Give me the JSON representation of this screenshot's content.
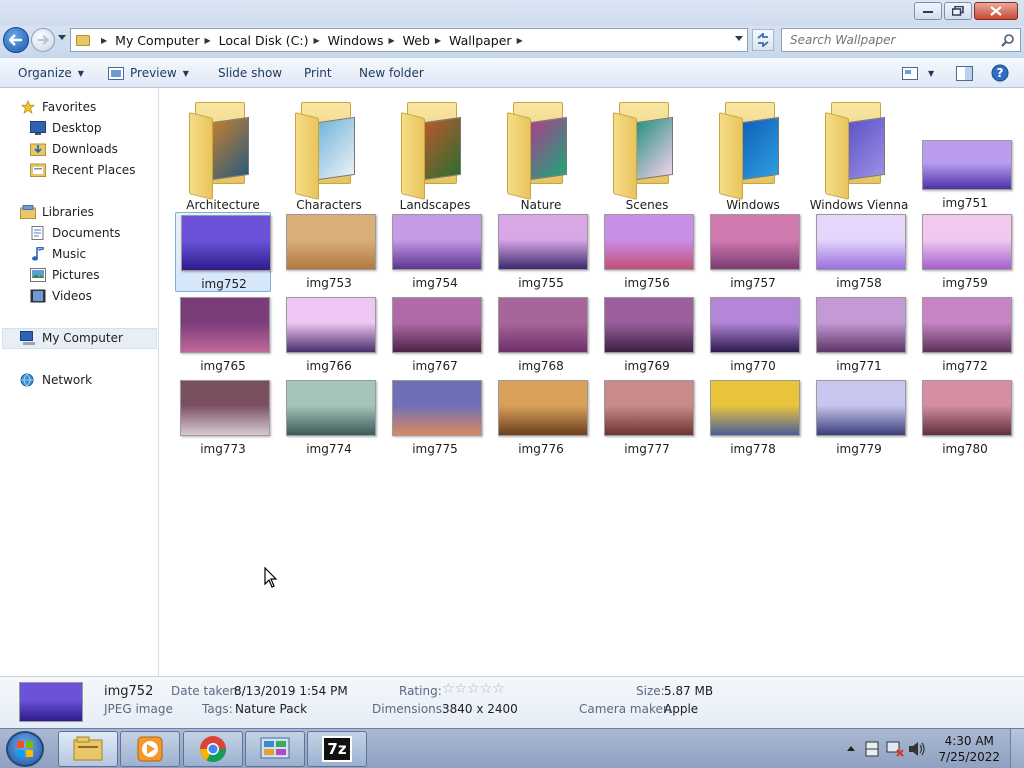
{
  "titlebar": {
    "minimize_label": "",
    "maximize_label": "",
    "close_label": ""
  },
  "address": {
    "crumbs": [
      "My Computer",
      "Local Disk (C:)",
      "Windows",
      "Web",
      "Wallpaper"
    ]
  },
  "search": {
    "placeholder": "Search Wallpaper"
  },
  "toolbar": {
    "organize": "Organize",
    "preview": "Preview",
    "slideshow": "Slide show",
    "print": "Print",
    "newfolder": "New folder"
  },
  "sidebar": {
    "favorites": "Favorites",
    "desktop": "Desktop",
    "downloads": "Downloads",
    "recent": "Recent Places",
    "libraries": "Libraries",
    "documents": "Documents",
    "music": "Music",
    "pictures": "Pictures",
    "videos": "Videos",
    "mycomputer": "My Computer",
    "network": "Network"
  },
  "items": [
    {
      "label": "Architecture",
      "kind": "folder",
      "colors": [
        "#c9812c",
        "#2d5b7c"
      ]
    },
    {
      "label": "Characters",
      "kind": "folder",
      "colors": [
        "#6db2d8",
        "#e8f0f6"
      ]
    },
    {
      "label": "Landscapes",
      "kind": "folder",
      "colors": [
        "#c0572e",
        "#2f6d2f"
      ]
    },
    {
      "label": "Nature",
      "kind": "folder",
      "colors": [
        "#b03a8c",
        "#1fa57a"
      ]
    },
    {
      "label": "Scenes",
      "kind": "folder",
      "colors": [
        "#1d8d7c",
        "#f0d0e8"
      ]
    },
    {
      "label": "Windows",
      "kind": "folder",
      "colors": [
        "#0d5db8",
        "#2f9de0"
      ]
    },
    {
      "label": "Windows Vienna",
      "kind": "folder",
      "colors": [
        "#5a4fc4",
        "#9a8fe6"
      ]
    },
    {
      "label": "img751",
      "kind": "image",
      "colors": [
        "#b99cf0",
        "#4d32a8"
      ]
    },
    {
      "label": "img752",
      "kind": "image",
      "selected": true,
      "colors": [
        "#6b52d8",
        "#2e1b8a"
      ]
    },
    {
      "label": "img753",
      "kind": "image",
      "colors": [
        "#d9b07a",
        "#b07a3f"
      ]
    },
    {
      "label": "img754",
      "kind": "image",
      "colors": [
        "#c59be6",
        "#5b3590"
      ]
    },
    {
      "label": "img755",
      "kind": "image",
      "colors": [
        "#d9a6e6",
        "#3b2a6e"
      ]
    },
    {
      "label": "img756",
      "kind": "image",
      "colors": [
        "#c98ee8",
        "#c25178"
      ]
    },
    {
      "label": "img757",
      "kind": "image",
      "colors": [
        "#d17ab0",
        "#7a3b72"
      ]
    },
    {
      "label": "img758",
      "kind": "image",
      "colors": [
        "#e6d6fb",
        "#9b6ee0"
      ]
    },
    {
      "label": "img759",
      "kind": "image",
      "colors": [
        "#f1c9ef",
        "#a65fd0"
      ]
    },
    {
      "label": "img765",
      "kind": "image",
      "colors": [
        "#7b3d7a",
        "#c2679a"
      ]
    },
    {
      "label": "img766",
      "kind": "image",
      "colors": [
        "#eec7f4",
        "#4a2f6b"
      ]
    },
    {
      "label": "img767",
      "kind": "image",
      "colors": [
        "#b06aa8",
        "#4d2347"
      ]
    },
    {
      "label": "img768",
      "kind": "image",
      "colors": [
        "#a6669a",
        "#6e2f6a"
      ]
    },
    {
      "label": "img769",
      "kind": "image",
      "colors": [
        "#9a5f9c",
        "#3b2044"
      ]
    },
    {
      "label": "img770",
      "kind": "image",
      "colors": [
        "#b386d8",
        "#2d1b4d"
      ]
    },
    {
      "label": "img771",
      "kind": "image",
      "colors": [
        "#c49ad6",
        "#5e3566"
      ]
    },
    {
      "label": "img772",
      "kind": "image",
      "colors": [
        "#c784c6",
        "#5b3158"
      ]
    },
    {
      "label": "img773",
      "kind": "image",
      "colors": [
        "#7a5061",
        "#d8c8d4"
      ]
    },
    {
      "label": "img774",
      "kind": "image",
      "colors": [
        "#a7c4b8",
        "#3b5b5b"
      ]
    },
    {
      "label": "img775",
      "kind": "image",
      "colors": [
        "#6f6fb7",
        "#d98a62"
      ]
    },
    {
      "label": "img776",
      "kind": "image",
      "colors": [
        "#d9a05a",
        "#6a3f1f"
      ]
    },
    {
      "label": "img777",
      "kind": "image",
      "colors": [
        "#c98a8a",
        "#6b3531"
      ]
    },
    {
      "label": "img778",
      "kind": "image",
      "colors": [
        "#e8c43a",
        "#4b5f9a"
      ]
    },
    {
      "label": "img779",
      "kind": "image",
      "colors": [
        "#c8c6ee",
        "#3a3f7a"
      ]
    },
    {
      "label": "img780",
      "kind": "image",
      "colors": [
        "#d48ea0",
        "#5e2f3d"
      ]
    }
  ],
  "details": {
    "name": "img752",
    "type": "JPEG image",
    "date_label": "Date taken:",
    "date_value": "8/13/2019 1:54 PM",
    "tags_label": "Tags:",
    "tags_value": "Nature Pack",
    "rating_label": "Rating:",
    "rating_stars": 0,
    "dim_label": "Dimensions:",
    "dim_value": "3840 x 2400",
    "size_label": "Size:",
    "size_value": "5.87 MB",
    "camera_label": "Camera maker:",
    "camera_value": "Apple",
    "thumb_colors": [
      "#6b52d8",
      "#2e1b8a"
    ]
  },
  "taskbar": {
    "time": "4:30 AM",
    "date": "7/25/2022",
    "apps": [
      "explorer",
      "media-player",
      "chrome",
      "control-panel",
      "7zip"
    ],
    "sevenzip_label": "7z"
  }
}
